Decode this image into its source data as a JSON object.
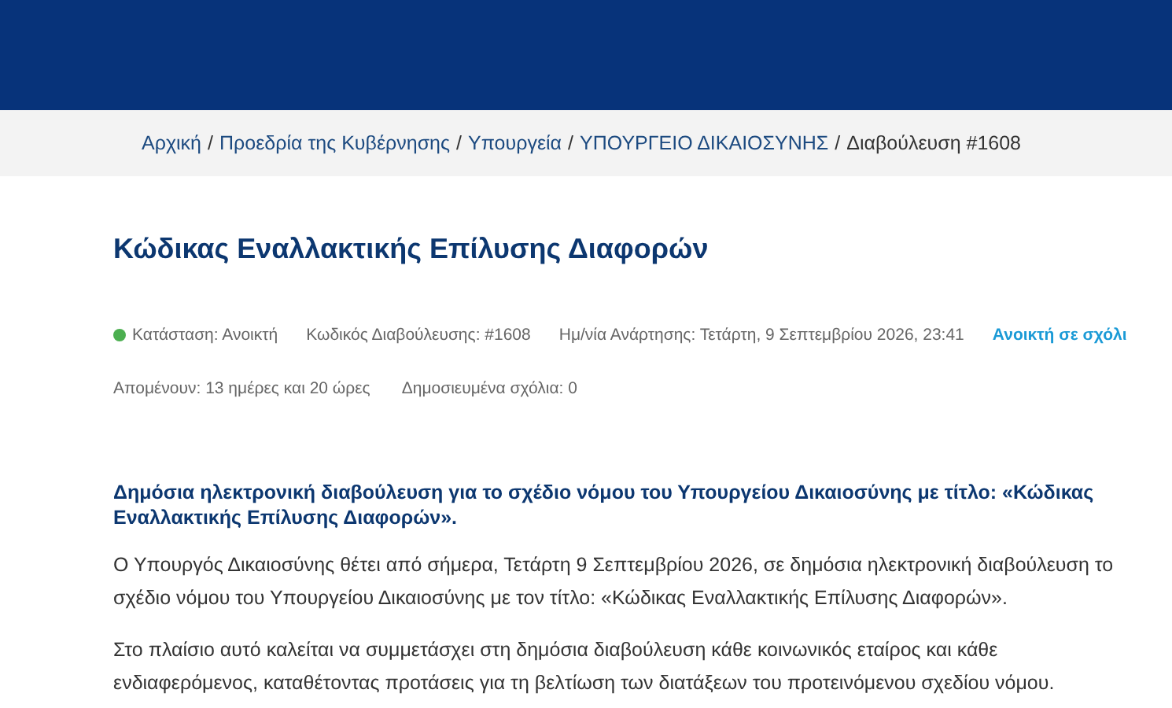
{
  "breadcrumb": [
    {
      "label": "Αρχική",
      "link": true
    },
    {
      "label": "Προεδρία της Κυβέρνησης",
      "link": true
    },
    {
      "label": "Υπουργεία",
      "link": true
    },
    {
      "label": "ΥΠΟΥΡΓΕΙΟ ΔΙΚΑΙΟΣΥΝΗΣ",
      "link": true
    },
    {
      "label": "Διαβούλευση #1608",
      "link": false
    }
  ],
  "breadcrumb_separator": "/",
  "title": "Κώδικας Εναλλακτικής Επίλυσης Διαφορών",
  "meta": [
    {
      "kind": "status",
      "text": "Κατάσταση: Ανοικτή",
      "color": "#4caf50"
    },
    {
      "kind": "text",
      "text": "Κωδικός Διαβούλευσης: #1608"
    },
    {
      "kind": "text",
      "text": "Ημ/νία Ανάρτησης: Τετάρτη, 9 Σεπτεμβρίου 2026, 23:41"
    },
    {
      "kind": "link",
      "text": "Ανοικτή σε σχόλι"
    }
  ],
  "meta_2": [
    "Απομένουν: 13 ημέρες και 20 ώρες",
    "Δημοσιευμένα σχόλια: 0"
  ],
  "lead": "Δημόσια ηλεκτρονική διαβούλευση για το σχέδιο νόμου του Υπουργείου Δικαιοσύνης με τίτλο: «Κώδικας Εναλλακτικής Επίλυσης Διαφορών».",
  "paragraphs": [
    "Ο Υπουργός Δικαιοσύνης θέτει από σήμερα, Τετάρτη 9 Σεπτεμβρίου 2026, σε δημόσια ηλεκτρονική διαβούλευση το σχέδιο νόμου του Υπουργείου Δικαιοσύνης με τον τίτλο: «Κώδικας Εναλλακτικής Επίλυσης Διαφορών».",
    "Στο πλαίσιο αυτό καλείται να συμμετάσχει στη δημόσια διαβούλευση κάθε κοινωνικός εταίρος και κάθε ενδιαφερόμενος, καταθέτοντας προτάσεις για τη βελτίωση των διατάξεων του προτεινόμενου σχεδίου νόμου."
  ]
}
